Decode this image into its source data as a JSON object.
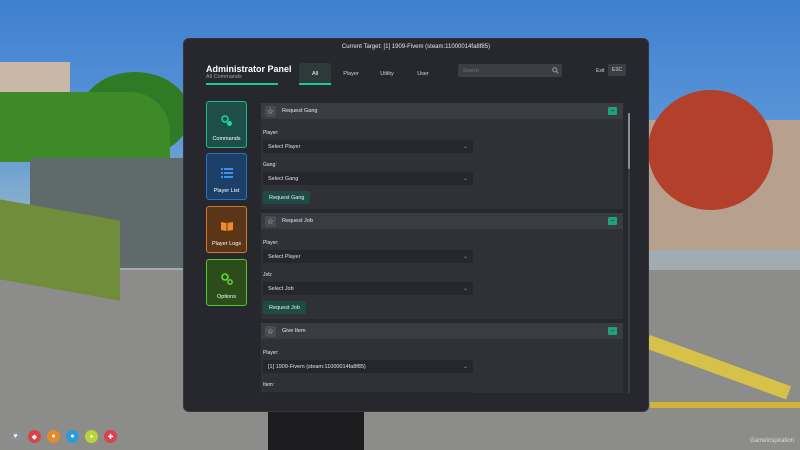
{
  "panel": {
    "current_target": "Current Target: [1] 1909-Fivem (steam:11000014fa8f85)",
    "title": "Administrator Panel",
    "subtitle": "All Commands",
    "search_placeholder": "Search",
    "exit_label": "Exit",
    "exit_key": "ESC",
    "accent_color": "#18c99a"
  },
  "tabs": [
    {
      "label": "All",
      "active": true
    },
    {
      "label": "Player",
      "active": false
    },
    {
      "label": "Utility",
      "active": false
    },
    {
      "label": "User",
      "active": false
    }
  ],
  "sidebar": [
    {
      "label": "Commands",
      "icon": "commands-icon",
      "color": "#19b893"
    },
    {
      "label": "Player List",
      "icon": "list-icon",
      "color": "#2a73c4"
    },
    {
      "label": "Player Logs",
      "icon": "book-icon",
      "color": "#d07a2a"
    },
    {
      "label": "Options",
      "icon": "gears-icon",
      "color": "#59c52e"
    }
  ],
  "commands": [
    {
      "title": "Request Gang",
      "player_label": "Player:",
      "player_value": "Select Player",
      "second_label": "Gang:",
      "second_value": "Select Gang",
      "button": "Request Gang"
    },
    {
      "title": "Request Job",
      "player_label": "Player:",
      "player_value": "Select Player",
      "second_label": "Job:",
      "second_value": "Select Job",
      "button": "Request Job"
    },
    {
      "title": "Give Item",
      "player_label": "Player:",
      "player_value": "[1] 1909-Fivem (steam:11000014fa8f85)",
      "second_label": "Item:"
    }
  ],
  "hud": [
    "heart",
    "shield",
    "food",
    "water",
    "stress",
    "health"
  ],
  "watermark": "GameInspiration"
}
